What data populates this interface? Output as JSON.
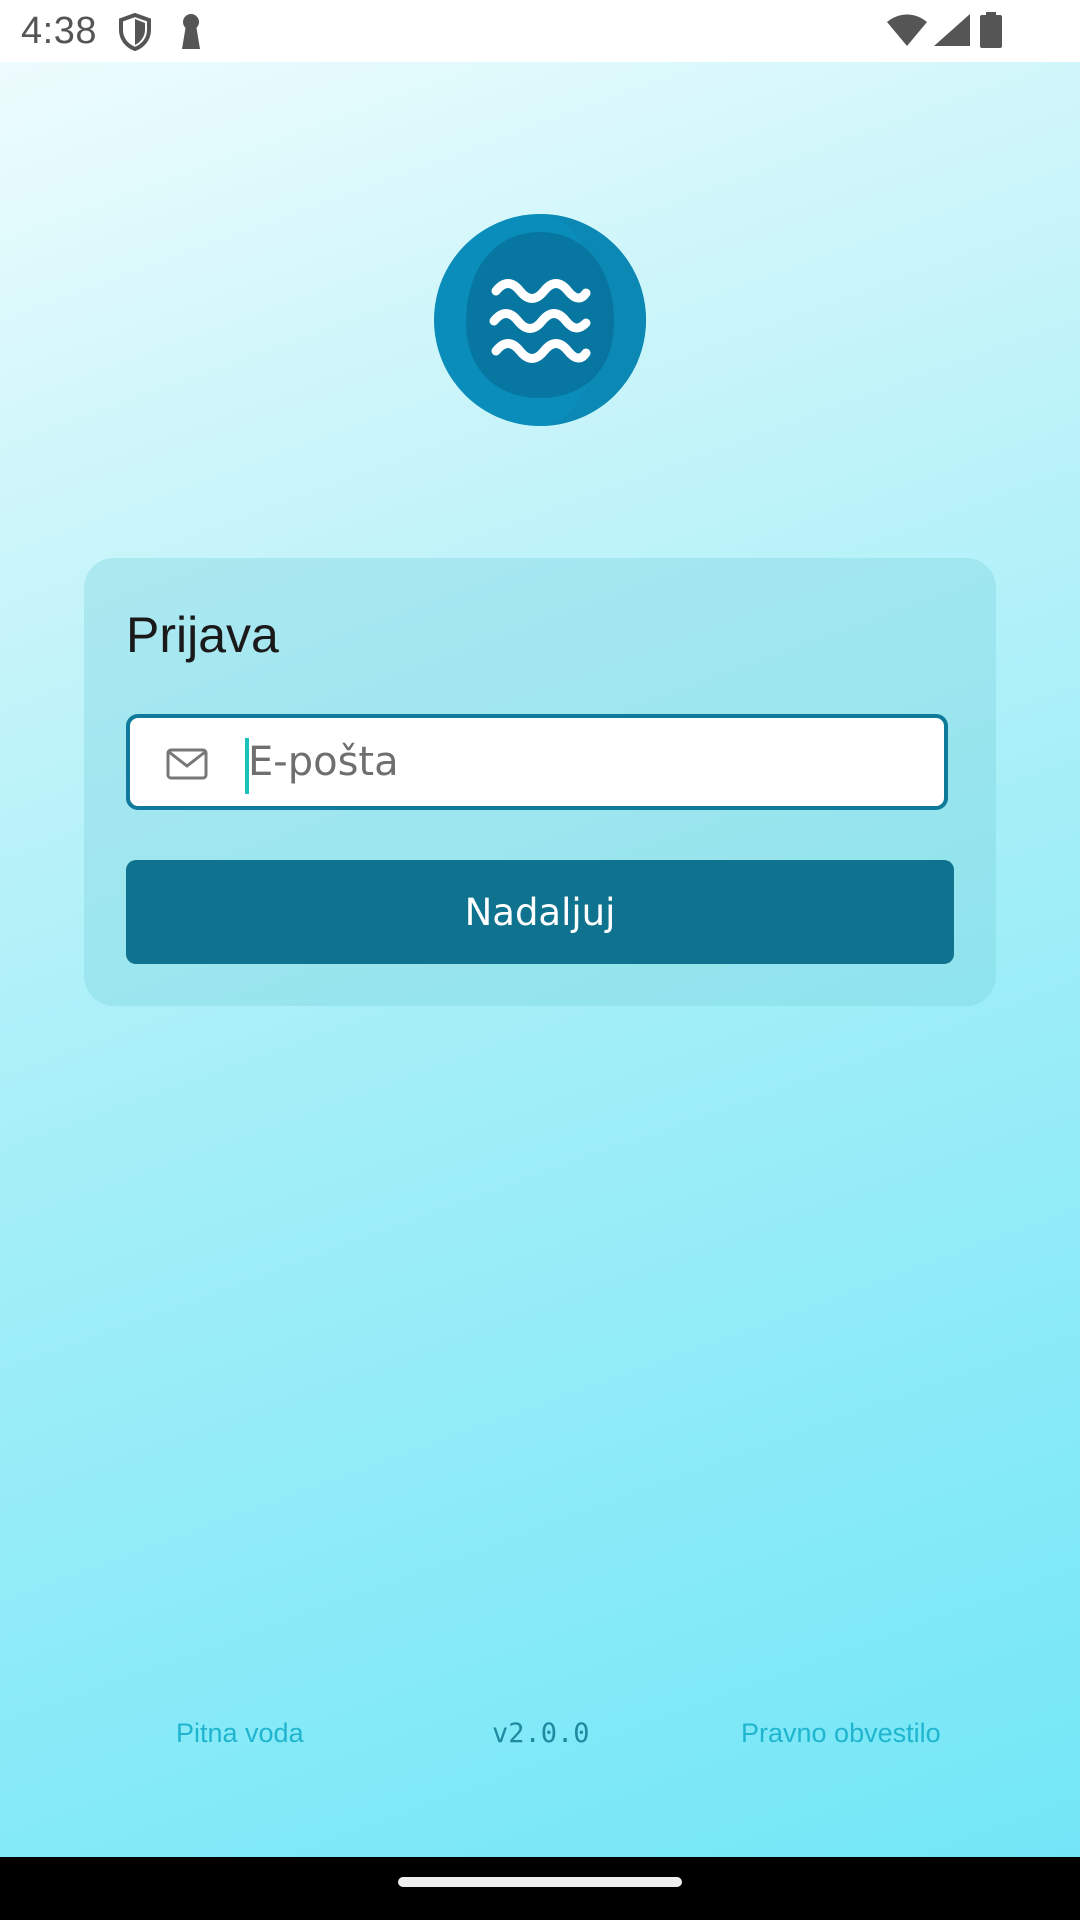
{
  "status_bar": {
    "time": "4:38",
    "icons": [
      "shield-icon",
      "keyhole-icon",
      "wifi-icon",
      "signal-icon",
      "battery-icon"
    ]
  },
  "logo": {
    "icon": "water-waves-icon"
  },
  "login": {
    "title": "Prijava",
    "email_placeholder": "E-pošta",
    "email_value": "",
    "continue_label": "Nadaljuj"
  },
  "footer": {
    "left_link": "Pitna voda",
    "version": "v2.0.0",
    "right_link": "Pravno obvestilo"
  },
  "colors": {
    "brand": "#0f728e",
    "accent_link": "#20b5cf",
    "field_border": "#0f7a9a"
  }
}
